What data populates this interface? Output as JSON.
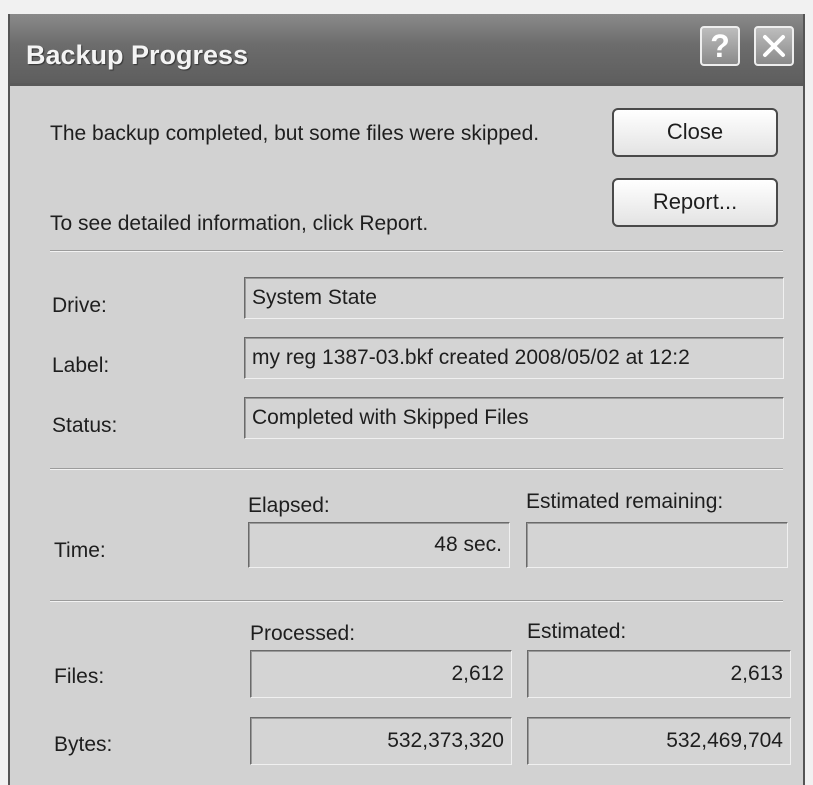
{
  "window": {
    "title": "Backup Progress",
    "help_label": "?"
  },
  "message": {
    "line1": "The backup completed, but some files were skipped.",
    "line2": "To see detailed information, click Report."
  },
  "buttons": {
    "close": "Close",
    "report": "Report..."
  },
  "details": {
    "drive_label": "Drive:",
    "drive_value": "System State",
    "label_label": "Label:",
    "label_value": "my reg 1387-03.bkf created 2008/05/02 at 12:2",
    "status_label": "Status:",
    "status_value": "Completed with Skipped Files"
  },
  "time": {
    "row_label": "Time:",
    "elapsed_header": "Elapsed:",
    "elapsed_value": "48 sec.",
    "remaining_header": "Estimated remaining:",
    "remaining_value": ""
  },
  "counts": {
    "processed_header": "Processed:",
    "estimated_header": "Estimated:",
    "files_label": "Files:",
    "files_processed": "2,612",
    "files_estimated": "2,613",
    "bytes_label": "Bytes:",
    "bytes_processed": "532,373,320",
    "bytes_estimated": "532,469,704"
  },
  "icons": {
    "help": "help-icon",
    "close": "close-icon"
  }
}
